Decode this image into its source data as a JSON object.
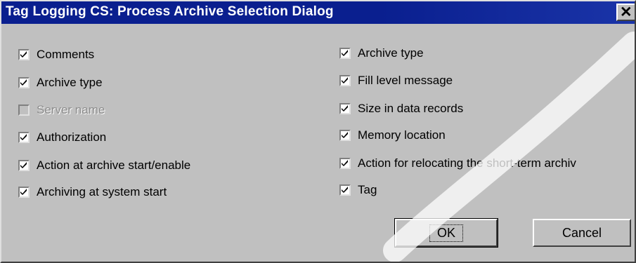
{
  "dialog": {
    "title": "Tag Logging CS: Process Archive Selection Dialog",
    "close_glyph": "✕"
  },
  "left_options": [
    {
      "label": "Comments",
      "checked": true,
      "enabled": true
    },
    {
      "label": "Archive type",
      "checked": true,
      "enabled": true
    },
    {
      "label": "Server name",
      "checked": false,
      "enabled": false
    },
    {
      "label": "Authorization",
      "checked": true,
      "enabled": true
    },
    {
      "label": "Action at archive start/enable",
      "checked": true,
      "enabled": true
    },
    {
      "label": "Archiving at system start",
      "checked": true,
      "enabled": true
    }
  ],
  "right_options": [
    {
      "label": "Archive type",
      "checked": true,
      "enabled": true
    },
    {
      "label": "Fill level message",
      "checked": true,
      "enabled": true
    },
    {
      "label": "Size in data records",
      "checked": true,
      "enabled": true
    },
    {
      "label": "Memory location",
      "checked": true,
      "enabled": true
    },
    {
      "label": "Action for relocating the short-term archiv",
      "checked": true,
      "enabled": true
    },
    {
      "label": "Tag",
      "checked": true,
      "enabled": true
    }
  ],
  "buttons": {
    "ok_label": "OK",
    "cancel_label": "Cancel"
  },
  "colors": {
    "titlebar": "#0a1f8f",
    "dialog_bg": "#c0c0c0",
    "disabled_text": "#8c8c8c"
  }
}
